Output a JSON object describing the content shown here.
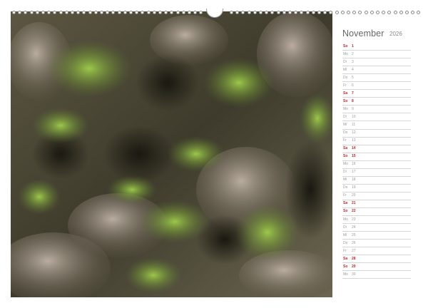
{
  "calendar": {
    "month": "November",
    "year": "2026",
    "days": [
      {
        "wd": "So",
        "num": "1",
        "weekend": true
      },
      {
        "wd": "Mo",
        "num": "2",
        "weekend": false
      },
      {
        "wd": "Di",
        "num": "3",
        "weekend": false
      },
      {
        "wd": "Mi",
        "num": "4",
        "weekend": false
      },
      {
        "wd": "Do",
        "num": "5",
        "weekend": false
      },
      {
        "wd": "Fr",
        "num": "6",
        "weekend": false
      },
      {
        "wd": "Sa",
        "num": "7",
        "weekend": true
      },
      {
        "wd": "So",
        "num": "8",
        "weekend": true
      },
      {
        "wd": "Mo",
        "num": "9",
        "weekend": false
      },
      {
        "wd": "Di",
        "num": "10",
        "weekend": false
      },
      {
        "wd": "Mi",
        "num": "11",
        "weekend": false
      },
      {
        "wd": "Do",
        "num": "12",
        "weekend": false
      },
      {
        "wd": "Fr",
        "num": "13",
        "weekend": false
      },
      {
        "wd": "Sa",
        "num": "14",
        "weekend": true
      },
      {
        "wd": "So",
        "num": "15",
        "weekend": true
      },
      {
        "wd": "Mo",
        "num": "16",
        "weekend": false
      },
      {
        "wd": "Di",
        "num": "17",
        "weekend": false
      },
      {
        "wd": "Mi",
        "num": "18",
        "weekend": false
      },
      {
        "wd": "Do",
        "num": "19",
        "weekend": false
      },
      {
        "wd": "Fr",
        "num": "20",
        "weekend": false
      },
      {
        "wd": "Sa",
        "num": "21",
        "weekend": true
      },
      {
        "wd": "So",
        "num": "22",
        "weekend": true
      },
      {
        "wd": "Mo",
        "num": "23",
        "weekend": false
      },
      {
        "wd": "Di",
        "num": "24",
        "weekend": false
      },
      {
        "wd": "Mi",
        "num": "25",
        "weekend": false
      },
      {
        "wd": "Do",
        "num": "26",
        "weekend": false
      },
      {
        "wd": "Fr",
        "num": "27",
        "weekend": false
      },
      {
        "wd": "Sa",
        "num": "28",
        "weekend": true
      },
      {
        "wd": "So",
        "num": "29",
        "weekend": true
      },
      {
        "wd": "Mo",
        "num": "30",
        "weekend": false
      }
    ]
  },
  "colors": {
    "weekend": "#c0282d",
    "weekday": "#9a9a9a",
    "rule": "#d6d6d6",
    "moss": "#7fa83a",
    "rock": "#6a6250"
  },
  "icons": {
    "binding": "spiral-binding-icon",
    "hanger": "hanger-hook-icon"
  }
}
